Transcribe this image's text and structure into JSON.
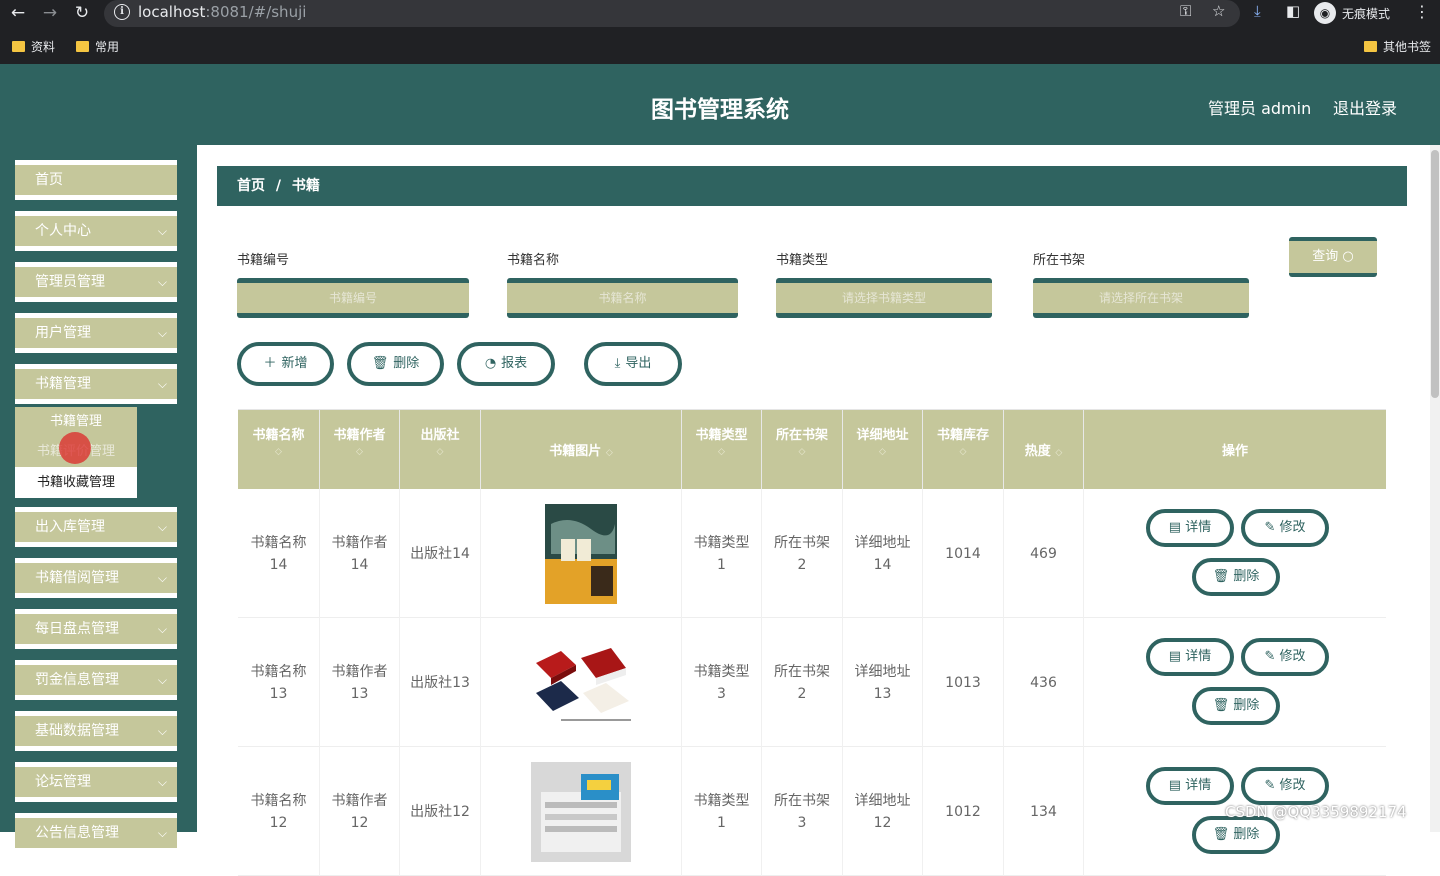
{
  "browser": {
    "url_host": "localhost",
    "url_rest": ":8081/#/shuji",
    "incognito_label": "无痕模式",
    "bookmarks": [
      "资料",
      "常用"
    ],
    "other_bookmarks": "其他书签"
  },
  "header": {
    "title": "图书管理系统",
    "admin": "管理员 admin",
    "logout": "退出登录"
  },
  "sidebar": {
    "items": [
      {
        "label": "首页",
        "chevron": false
      },
      {
        "label": "个人中心",
        "chevron": true
      },
      {
        "label": "管理员管理",
        "chevron": true
      },
      {
        "label": "用户管理",
        "chevron": true
      },
      {
        "label": "书籍管理",
        "chevron": true
      },
      {
        "label": "出入库管理",
        "chevron": true
      },
      {
        "label": "书籍借阅管理",
        "chevron": true
      },
      {
        "label": "每日盘点管理",
        "chevron": true
      },
      {
        "label": "罚金信息管理",
        "chevron": true
      },
      {
        "label": "基础数据管理",
        "chevron": true
      },
      {
        "label": "论坛管理",
        "chevron": true
      },
      {
        "label": "公告信息管理",
        "chevron": true
      }
    ],
    "submenu": [
      "书籍管理",
      "书籍评价管理",
      "书籍收藏管理"
    ]
  },
  "breadcrumb": {
    "home": "首页",
    "sep": "/",
    "current": "书籍"
  },
  "filters": {
    "labels": [
      "书籍编号",
      "书籍名称",
      "书籍类型",
      "所在书架"
    ],
    "placeholders": [
      "书籍编号",
      "书籍名称",
      "请选择书籍类型",
      "请选择所在书架"
    ],
    "query": "查询"
  },
  "toolbar": {
    "add": "新增",
    "delete": "删除",
    "report": "报表",
    "export": "导出"
  },
  "table": {
    "headers": [
      "书籍名称",
      "书籍作者",
      "出版社",
      "书籍图片",
      "书籍类型",
      "所在书架",
      "详细地址",
      "书籍库存",
      "热度",
      "操作"
    ],
    "rows": [
      {
        "name": "书籍名称14",
        "author": "书籍作者14",
        "publisher": "出版社14",
        "type": "书籍类型1",
        "shelf": "所在书架2",
        "address": "详细地址14",
        "stock": "1014",
        "heat": "469"
      },
      {
        "name": "书籍名称13",
        "author": "书籍作者13",
        "publisher": "出版社13",
        "type": "书籍类型3",
        "shelf": "所在书架2",
        "address": "详细地址13",
        "stock": "1013",
        "heat": "436"
      },
      {
        "name": "书籍名称12",
        "author": "书籍作者12",
        "publisher": "出版社12",
        "type": "书籍类型1",
        "shelf": "所在书架3",
        "address": "详细地址12",
        "stock": "1012",
        "heat": "134"
      }
    ],
    "actions": {
      "detail": "详情",
      "edit": "修改",
      "delete": "删除"
    }
  },
  "watermark": "CSDN @QQ3359892174",
  "colors": {
    "primary": "#2f6360",
    "accent": "#c5c79b"
  }
}
